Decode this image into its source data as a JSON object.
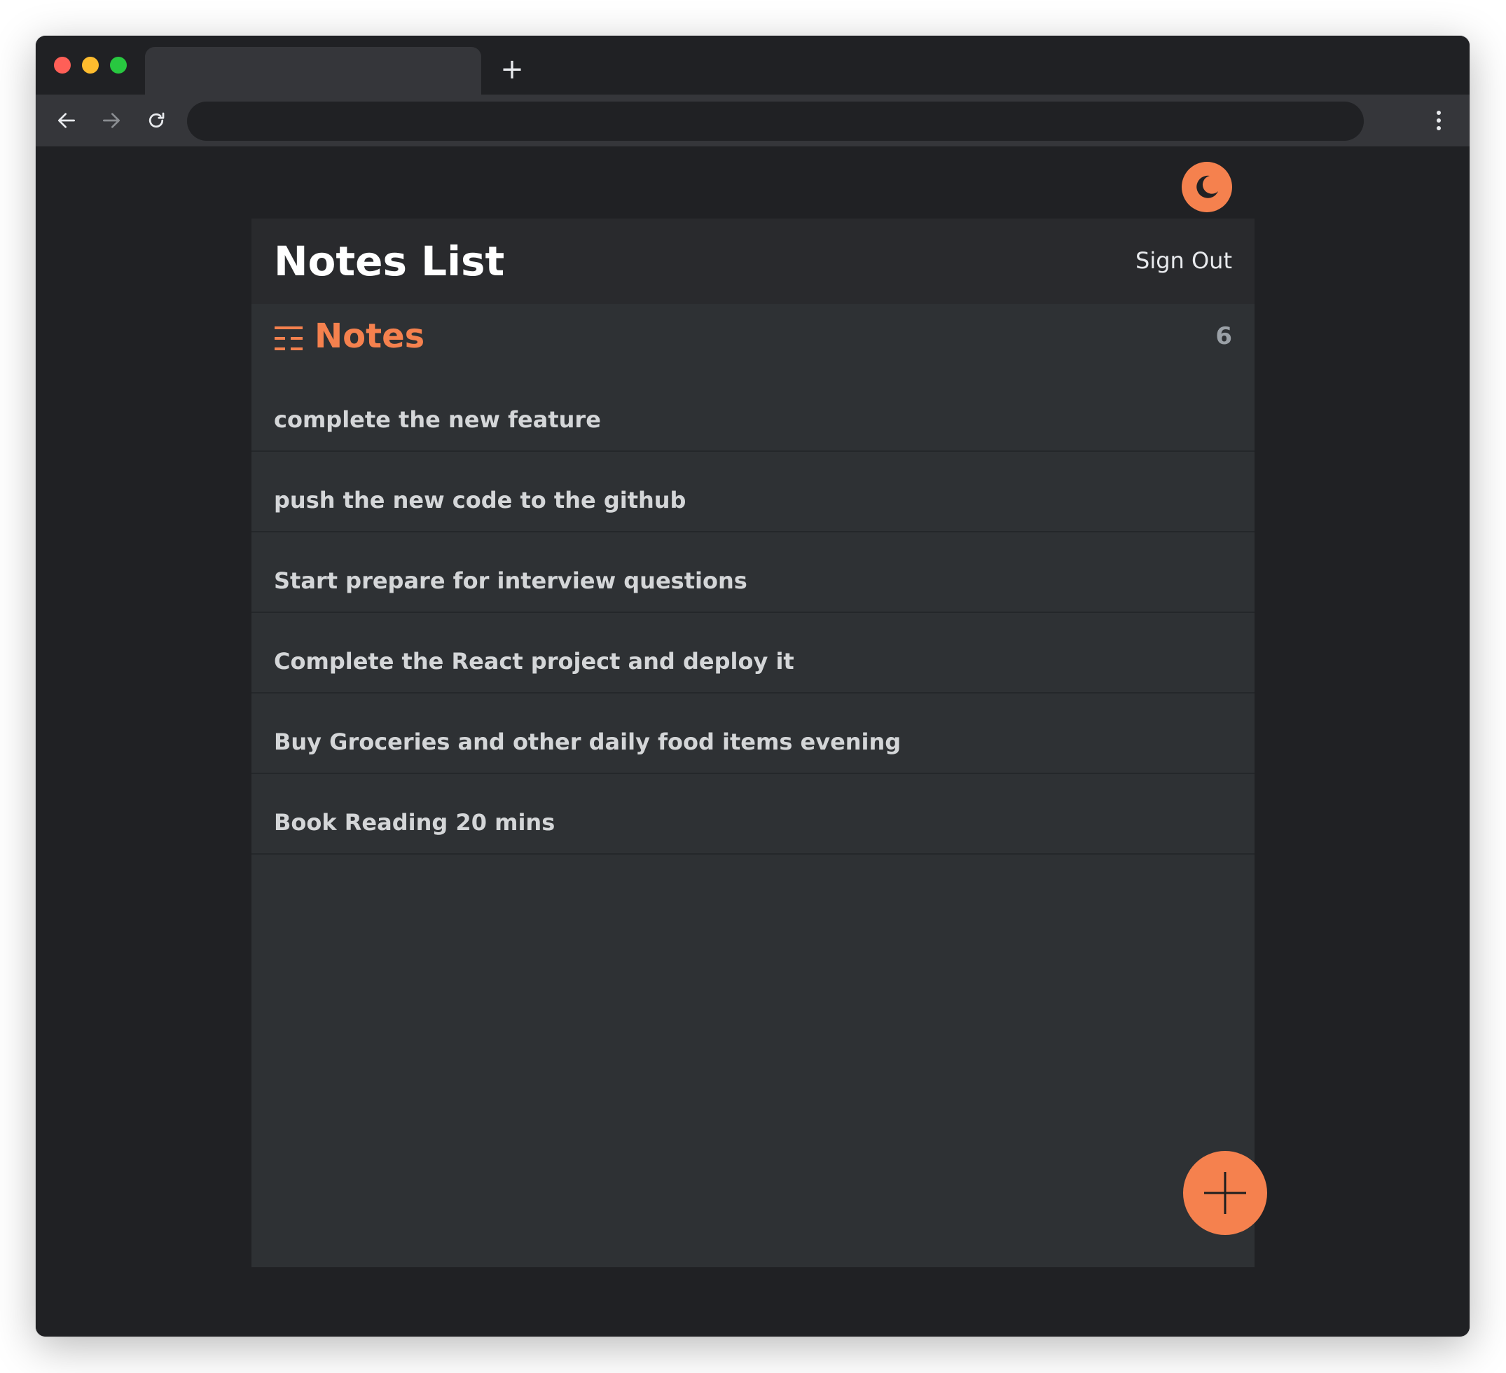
{
  "browser": {
    "tab_title": "",
    "new_tab_label": "+",
    "address_value": ""
  },
  "colors": {
    "accent": "#f5814e",
    "background": "#202124",
    "card": "#2e3134",
    "header": "#292a2d"
  },
  "icons": {
    "theme_toggle": "crescent-moon-icon",
    "section": "list-icon",
    "fab": "plus-icon"
  },
  "header": {
    "title": "Notes List",
    "sign_out_label": "Sign Out"
  },
  "notes_section": {
    "title": "Notes",
    "count": "6",
    "items": [
      {
        "label": "complete the new feature"
      },
      {
        "label": "push the new code to the github"
      },
      {
        "label": "Start prepare for interview questions"
      },
      {
        "label": "Complete the React project and deploy it"
      },
      {
        "label": "Buy Groceries and other daily food items evening"
      },
      {
        "label": "Book Reading 20 mins"
      }
    ]
  }
}
